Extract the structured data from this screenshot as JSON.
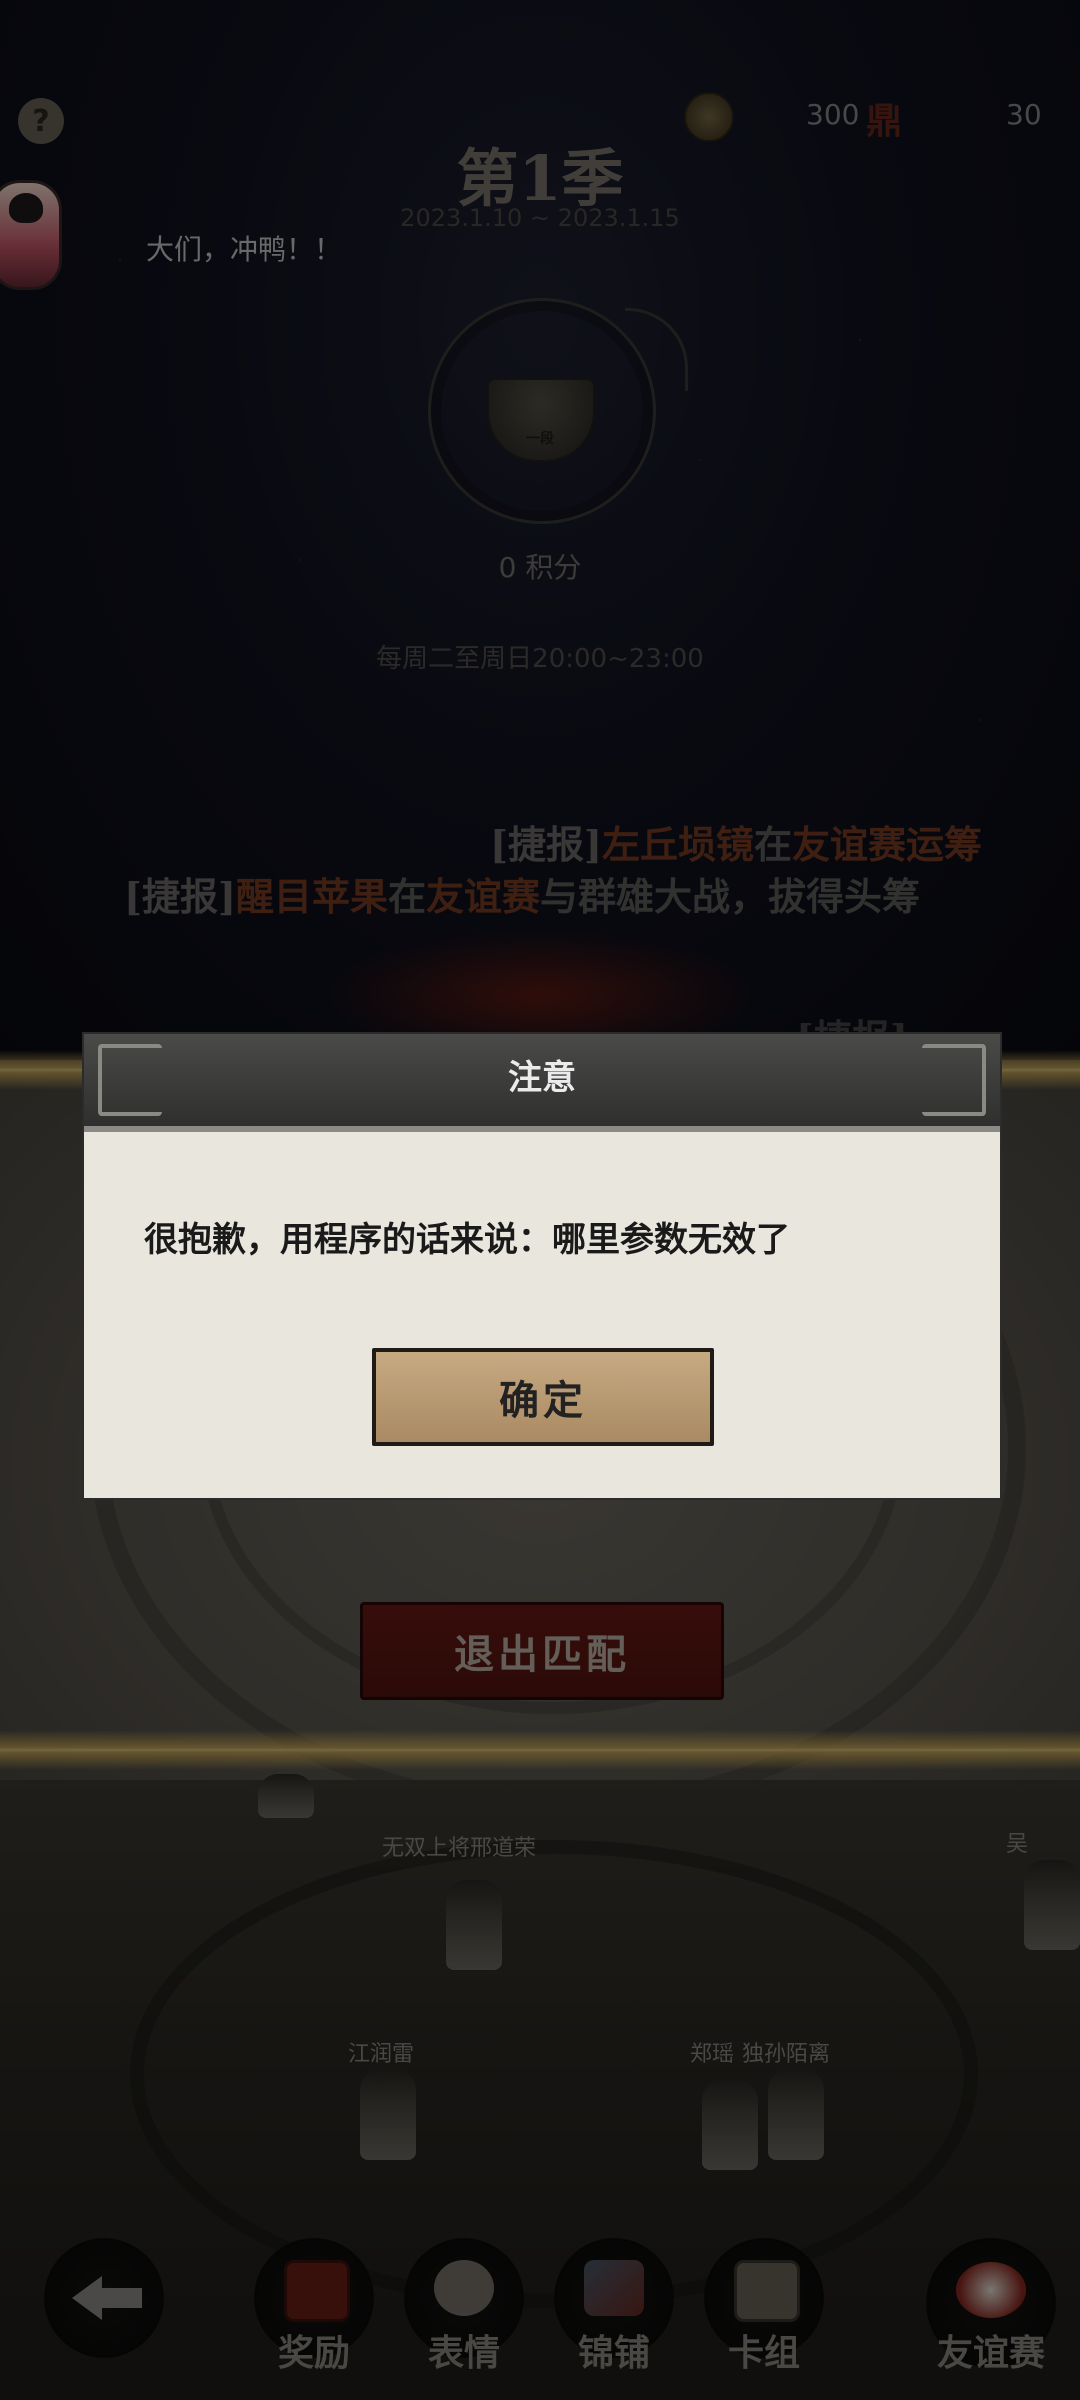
{
  "header": {
    "help_icon": "question-icon",
    "currency_value": "300",
    "currency_symbol": "鼎",
    "secondary_value": "30"
  },
  "season": {
    "title": "第1季",
    "dates": "2023.1.10 ~ 2023.1.15",
    "rank_glyph": "一段",
    "points": "0 积分",
    "schedule": "每周二至周日20:00~23:00"
  },
  "chat": {
    "message": "大们，冲鸭！！"
  },
  "ticker": [
    {
      "bracket": "[捷报]",
      "name": "左丘埙镜",
      "mid": "在",
      "event": "友谊赛",
      "tail": "运筹"
    },
    {
      "bracket": "[捷报]",
      "name": "醒目苹果",
      "mid": "在",
      "event": "友谊赛",
      "tail": "与群雄大战，拔得头筹"
    },
    {
      "bracket": "[捷报]",
      "name": "",
      "mid": "",
      "event": "",
      "tail": ""
    }
  ],
  "arena": {
    "players": [
      "无双上将邢道荣",
      "江润雷",
      "郑瑶",
      "独孙陌离",
      "吴"
    ]
  },
  "buttons": {
    "exit_match": "退出匹配"
  },
  "modal": {
    "title": "注意",
    "message": "很抱歉，用程序的话来说：哪里参数无效了",
    "confirm": "确定"
  },
  "nav": {
    "back_icon": "back-arrow-icon",
    "items": [
      {
        "label": "奖励",
        "icon": "reward-chest-icon"
      },
      {
        "label": "表情",
        "icon": "emote-icon"
      },
      {
        "label": "锦铺",
        "icon": "shop-icon"
      },
      {
        "label": "卡组",
        "icon": "card-deck-icon"
      },
      {
        "label": "友谊赛",
        "icon": "friendly-match-icon"
      }
    ]
  },
  "colors": {
    "exit_button": "#5e1814",
    "confirm_button": "#b8976f",
    "ticker_highlight": "#7a3d22",
    "gold_band": "#e4c66f"
  }
}
